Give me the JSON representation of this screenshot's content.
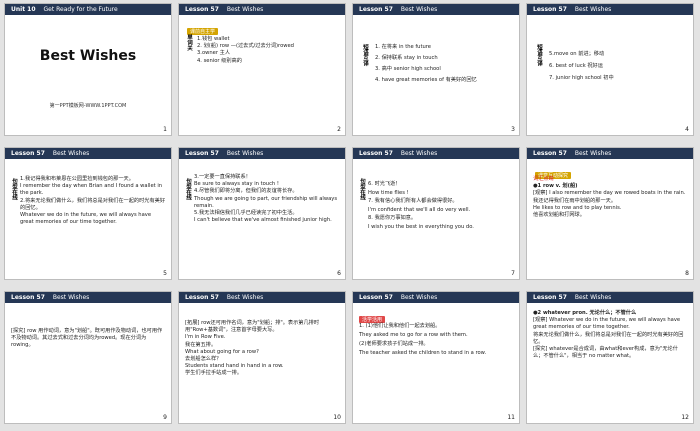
{
  "slides": [
    {
      "n": "1",
      "header_unit": "Unit 10",
      "header_title": "Get Ready for the Future",
      "title": "Best Wishes",
      "subtitle": "第一PPT模板网-WWW.1PPT.COM"
    },
    {
      "n": "2",
      "header_unit": "Lesson 57",
      "header_title": "Best Wishes",
      "badge": "课前自主学",
      "lines": [
        "1.钱包 wallet",
        "2. 划(船) row —(过去式/过去分词)rowed",
        "3.owner 主人",
        "4. senior 级别高的"
      ],
      "side": "单词关"
    },
    {
      "n": "3",
      "header_unit": "Lesson 57",
      "header_title": "Best Wishes",
      "side": "短语互译",
      "lines": [
        "1. 在将来 in the future",
        "2. 保持联系 stay in touch",
        "3. 高中 senior high school",
        "4. have great memories of 有美好的回忆"
      ]
    },
    {
      "n": "4",
      "header_unit": "Lesson 57",
      "header_title": "Best Wishes",
      "side": "短语互译",
      "lines": [
        "5.move on 前进；移动",
        "6. best of luck 祝好运",
        "7. junior high school 初中"
      ]
    },
    {
      "n": "5",
      "header_unit": "Lesson 57",
      "header_title": "Best Wishes",
      "side": "句型在线",
      "lines": [
        "1.我记得我和布莱恩在公园里捡到钱包的那一天。",
        "I remember the day when Brian and I found a wallet in the park.",
        "2.将来无论我们做什么，我们将总是对我们在一起的时光有美好的回忆。",
        "Whatever we do in the future, we will always have great memories of our time together."
      ]
    },
    {
      "n": "6",
      "header_unit": "Lesson 57",
      "header_title": "Best Wishes",
      "side": "句型在线",
      "lines": [
        "3.一定要一直保持联系！",
        "Be sure to always stay in touch !",
        "4.尽管我们即将分离，但我们的友谊将长存。",
        "Though we are going to part, our friendship will always remain.",
        "5.我无法相信我们几乎已经读完了初中生活。",
        "I can't believe that we've almost finished junior high."
      ]
    },
    {
      "n": "7",
      "header_unit": "Lesson 57",
      "header_title": "Best Wishes",
      "side": "句型在线",
      "lines": [
        "6. 时光飞逝！",
        "How time flies !",
        "7. 我有信心我们所有人都会做得很好。",
        "I'm confident that we'll all do very well.",
        "8. 我愿你万事如意。",
        "I wish you the best in everything you do."
      ]
    },
    {
      "n": "8",
      "header_unit": "Lesson 57",
      "header_title": "Best Wishes",
      "badge": "课堂互动探究",
      "lines": [
        "词汇点睛",
        "●1 row v. 划(船)",
        "[观察] I also remember the day we rowed boats in the rain.",
        "我还记得我们在雨中划船的那一天。",
        "He likes to row and to play tennis.",
        "他喜欢划船和打网球。"
      ]
    },
    {
      "n": "9",
      "header_unit": "Lesson 57",
      "header_title": "Best Wishes",
      "lines": [
        "[探究] row 用作动词，意为\"划船\"。既可用作及物动词，也可用作不及物动词。其过去式和过去分词均为rowed。现在分词为rowing。"
      ]
    },
    {
      "n": "10",
      "header_unit": "Lesson 57",
      "header_title": "Best Wishes",
      "lines": [
        "[拓展] row还可用作名词，意为\"划船；排\"。表示第几排时用\"Row+基数词\"，注意首字母要大写。",
        "I'm in Row Five.",
        "我在第五排。",
        "What about going for a row?",
        "去划船怎么样？",
        "Students stand hand in hand in a row.",
        "学生们手拉手站成一排。"
      ]
    },
    {
      "n": "11",
      "header_unit": "Lesson 57",
      "header_title": "Best Wishes",
      "badge": "活学活用",
      "lines": [
        "1. (1)他们让我和他们一起去划船。",
        "They asked me to go for a row with them.",
        "(2)老师要求孩子们站成一排。",
        "The teacher asked the children to stand in a row."
      ]
    },
    {
      "n": "12",
      "header_unit": "Lesson 57",
      "header_title": "Best Wishes",
      "lines": [
        "●2 whatever pron. 无论什么；不管什么",
        "[观察] Whatever we do in the future, we will always have great memories of our time together.",
        "将来无论我们做什么，我们将总是对我们在一起的时光有美好的回忆。",
        "[探究] whatever是合成词，由what和ever构成，意为\"无论什么；不管什么\"，相当于 no matter what。"
      ]
    }
  ]
}
